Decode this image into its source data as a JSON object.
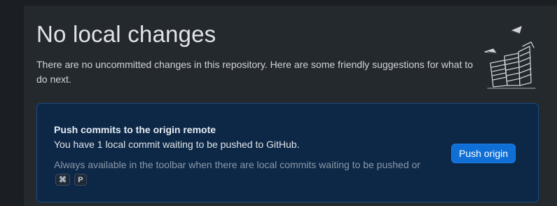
{
  "header": {
    "title": "No local changes",
    "subtitle": "There are no uncommitted changes in this repository. Here are some friendly suggestions for what to do next."
  },
  "illustration": {
    "icon": "paper-stacks-illustration-icon"
  },
  "suggestion_card": {
    "title": "Push commits to the origin remote",
    "description": "You have 1 local commit waiting to be pushed to GitHub.",
    "hint_text": "Always available in the toolbar when there are local commits waiting to be pushed or",
    "shortcut_keys": [
      "⌘",
      "P"
    ],
    "button_label": "Push origin"
  },
  "colors": {
    "background": "#24292e",
    "card_background": "#0d2847",
    "card_border": "#1a4a80",
    "accent_button": "#0f6fd6"
  }
}
